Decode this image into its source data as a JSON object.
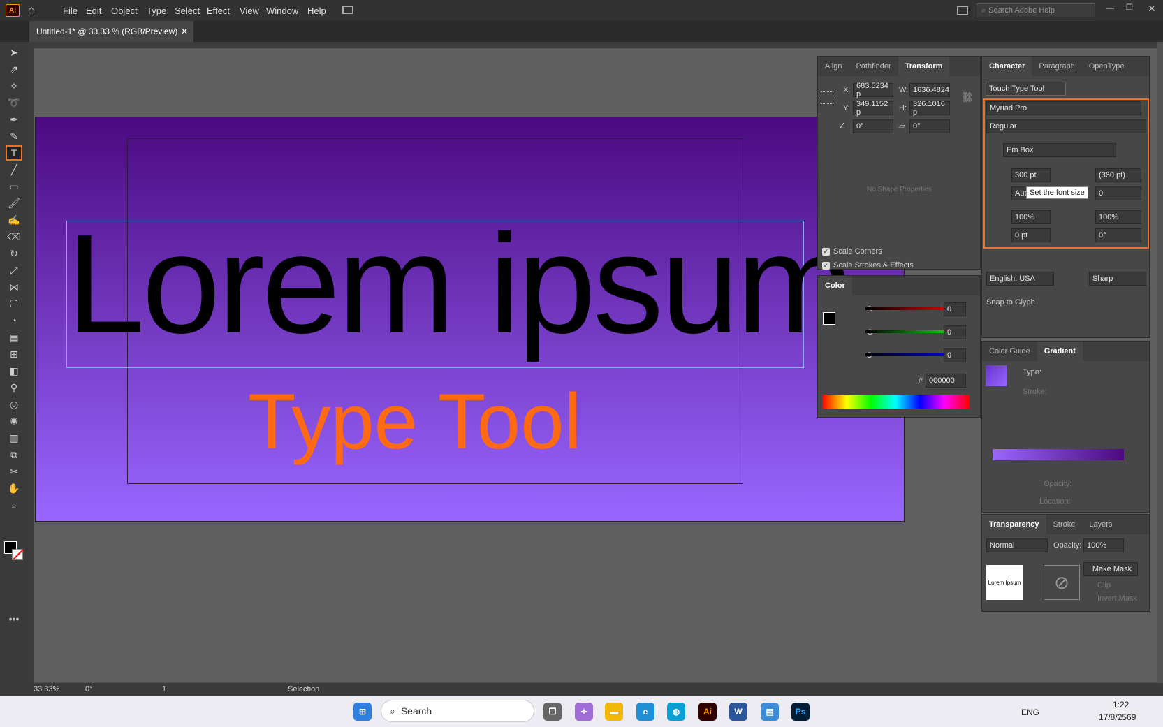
{
  "app": {
    "logo": "Ai",
    "accent": "#ff9a00"
  },
  "menu": [
    "File",
    "Edit",
    "Object",
    "Type",
    "Select",
    "Effect",
    "View",
    "Window",
    "Help"
  ],
  "search": {
    "placeholder": "Search Adobe Help"
  },
  "document": {
    "tab": "Untitled-1* @ 33.33 % (RGB/Preview)"
  },
  "canvas": {
    "headline": "Lorem ipsum",
    "subhead": "Type Tool",
    "subhead_color": "#ff6a13",
    "gradient": [
      "#4b0a80",
      "#9966ff"
    ]
  },
  "transform_panel": {
    "tabs": [
      "Align",
      "Pathfinder",
      "Transform"
    ],
    "x": "683.5234 p",
    "y": "349.1152 p",
    "w": "1636.4824",
    "h": "326.1016 p",
    "angle": "0°",
    "shear": "0°",
    "x_label": "X:",
    "y_label": "Y:",
    "w_label": "W:",
    "h_label": "H:",
    "no_shape": "No Shape Properties",
    "scale_corners": "Scale Corners",
    "scale_strokes": "Scale Strokes & Effects"
  },
  "color_panel": {
    "title": "Color",
    "r_label": "R",
    "g_label": "G",
    "b_label": "B",
    "r": "0",
    "g": "0",
    "b": "0",
    "hex_label": "#",
    "hex": "000000"
  },
  "character_panel": {
    "tabs": [
      "Character",
      "Paragraph",
      "OpenType"
    ],
    "touch_type": "Touch Type Tool",
    "font": "Myriad Pro",
    "style": "Regular",
    "em_box": "Em Box",
    "size": "300 pt",
    "leading": "(360 pt)",
    "kerning": "Auto",
    "tracking": "0",
    "vscale": "100%",
    "hscale": "100%",
    "baseline": "0 pt",
    "rotate": "0°",
    "tooltip": "Set the font size",
    "language": "English: USA",
    "aa": "Sharp",
    "snap": "Snap to Glyph"
  },
  "gradient_panel": {
    "tabs": [
      "Color Guide",
      "Gradient"
    ],
    "type_label": "Type:",
    "stroke_label": "Stroke:",
    "opacity_label": "Opacity:",
    "location_label": "Location:"
  },
  "transparency_panel": {
    "tabs": [
      "Transparency",
      "Stroke",
      "Layers"
    ],
    "mode": "Normal",
    "opacity_label": "Opacity:",
    "opacity": "100%",
    "make_mask": "Make Mask",
    "clip": "Clip",
    "invert": "Invert Mask",
    "thumb_text": "Lorem Ipsum"
  },
  "status": {
    "zoom": "33.33%",
    "rotation": "0°",
    "artboard": "1",
    "tool": "Selection"
  },
  "taskbar": {
    "search": "Search",
    "lang": "ENG",
    "time": "1:22",
    "date": "17/8/2569"
  }
}
